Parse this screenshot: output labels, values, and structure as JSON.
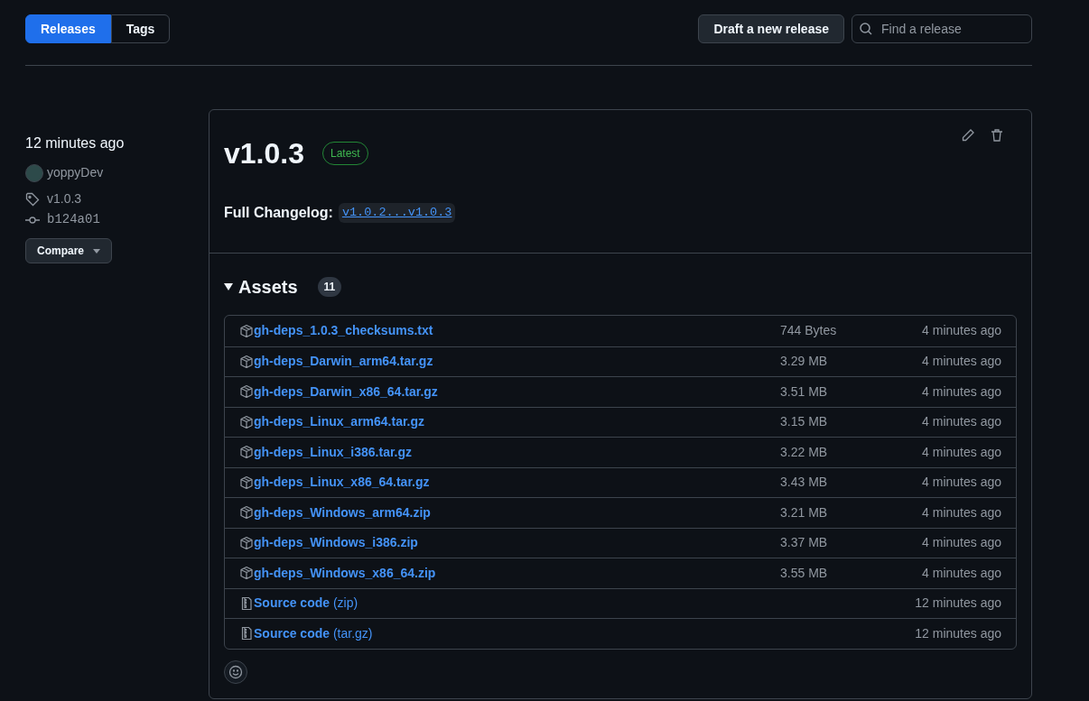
{
  "tabs": [
    {
      "label": "Releases",
      "selected": true
    },
    {
      "label": "Tags",
      "selected": false
    }
  ],
  "draft_button": "Draft a new release",
  "search": {
    "placeholder": "Find a release"
  },
  "sidebar": {
    "time": "12 minutes ago",
    "author": "yoppyDev",
    "tag": "v1.0.3",
    "commit": "b124a01",
    "compare_button": "Compare"
  },
  "release": {
    "title": "v1.0.3",
    "badge": "Latest",
    "changelog_label": "Full Changelog:",
    "changelog_link": "v1.0.2...v1.0.3"
  },
  "assets": {
    "title": "Assets",
    "count": "11",
    "expanded": true,
    "items": [
      {
        "kind": "package",
        "name": "gh-deps_1.0.3_checksums.txt",
        "size": "744 Bytes",
        "time": "4 minutes ago"
      },
      {
        "kind": "package",
        "name": "gh-deps_Darwin_arm64.tar.gz",
        "size": "3.29 MB",
        "time": "4 minutes ago"
      },
      {
        "kind": "package",
        "name": "gh-deps_Darwin_x86_64.tar.gz",
        "size": "3.51 MB",
        "time": "4 minutes ago"
      },
      {
        "kind": "package",
        "name": "gh-deps_Linux_arm64.tar.gz",
        "size": "3.15 MB",
        "time": "4 minutes ago"
      },
      {
        "kind": "package",
        "name": "gh-deps_Linux_i386.tar.gz",
        "size": "3.22 MB",
        "time": "4 minutes ago"
      },
      {
        "kind": "package",
        "name": "gh-deps_Linux_x86_64.tar.gz",
        "size": "3.43 MB",
        "time": "4 minutes ago"
      },
      {
        "kind": "package",
        "name": "gh-deps_Windows_arm64.zip",
        "size": "3.21 MB",
        "time": "4 minutes ago"
      },
      {
        "kind": "package",
        "name": "gh-deps_Windows_i386.zip",
        "size": "3.37 MB",
        "time": "4 minutes ago"
      },
      {
        "kind": "package",
        "name": "gh-deps_Windows_x86_64.zip",
        "size": "3.55 MB",
        "time": "4 minutes ago"
      },
      {
        "kind": "source",
        "name": "**Source code** (zip)",
        "time": "12 minutes ago"
      },
      {
        "kind": "source",
        "name": "**Source code** (tar.gz)",
        "time": "12 minutes ago"
      }
    ]
  }
}
